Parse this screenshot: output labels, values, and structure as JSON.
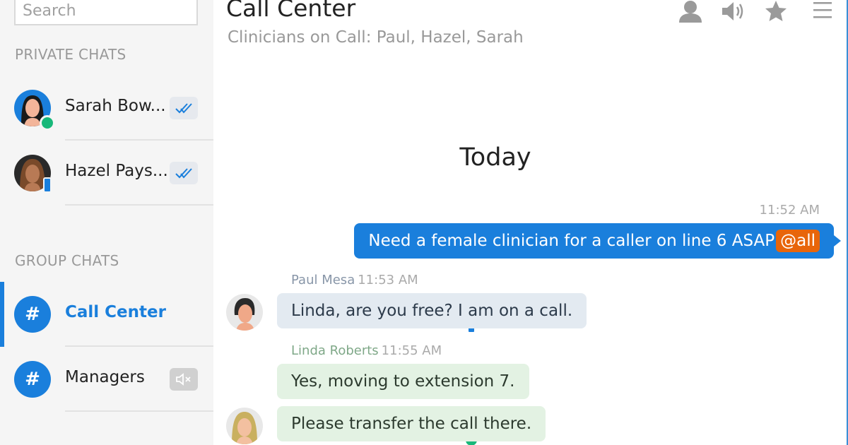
{
  "search": {
    "placeholder": "Search"
  },
  "sidebar": {
    "private_title": "PRIVATE CHATS",
    "group_title": "GROUP CHATS",
    "private": [
      {
        "name": "Sarah Bow...",
        "status": "online"
      },
      {
        "name": "Hazel Pays...",
        "status": "mobile"
      }
    ],
    "groups": [
      {
        "name": "Call Center",
        "active": true
      },
      {
        "name": "Managers",
        "muted": true
      }
    ]
  },
  "header": {
    "title": "Call Center",
    "subtitle": "Clinicians on Call: Paul, Hazel, Sarah"
  },
  "conversation": {
    "day": "Today",
    "outgoing": {
      "time": "11:52 AM",
      "text": "Need a female clinician for a caller on line 6 ASAP",
      "mention": "@all"
    },
    "paul": {
      "name": "Paul Mesa",
      "time": "11:53 AM",
      "text": "Linda, are you free? I am on a call."
    },
    "linda": {
      "name": "Linda Roberts",
      "time": "11:55 AM",
      "text1": "Yes, moving to extension 7.",
      "text2": "Please transfer the call there."
    }
  },
  "colors": {
    "accent": "#1a7fdc",
    "mention": "#e8650a",
    "online": "#18b87a"
  }
}
